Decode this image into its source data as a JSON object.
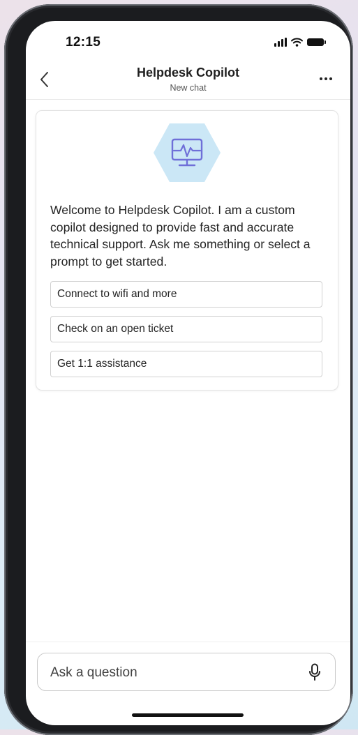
{
  "status_bar": {
    "time": "12:15",
    "icons": [
      "signal-icon",
      "wifi-icon",
      "battery-icon"
    ]
  },
  "header": {
    "back_icon": "chevron-left-icon",
    "title": "Helpdesk Copilot",
    "subtitle": "New chat",
    "more_icon": "more-horizontal-icon"
  },
  "welcome_card": {
    "icon": "monitor-heartbeat-icon",
    "icon_colors": {
      "hexagon": "#cbe7f6",
      "glyph": "#6f6fd8"
    },
    "message": "Welcome to Helpdesk Copilot. I am a custom copilot designed to provide fast and accurate technical support. Ask me something or select a prompt to get started.",
    "prompts": [
      {
        "label": "Connect to wifi and more"
      },
      {
        "label": "Check on an open ticket"
      },
      {
        "label": "Get 1:1 assistance"
      }
    ]
  },
  "composer": {
    "placeholder": "Ask a question",
    "mic_icon": "microphone-icon"
  }
}
